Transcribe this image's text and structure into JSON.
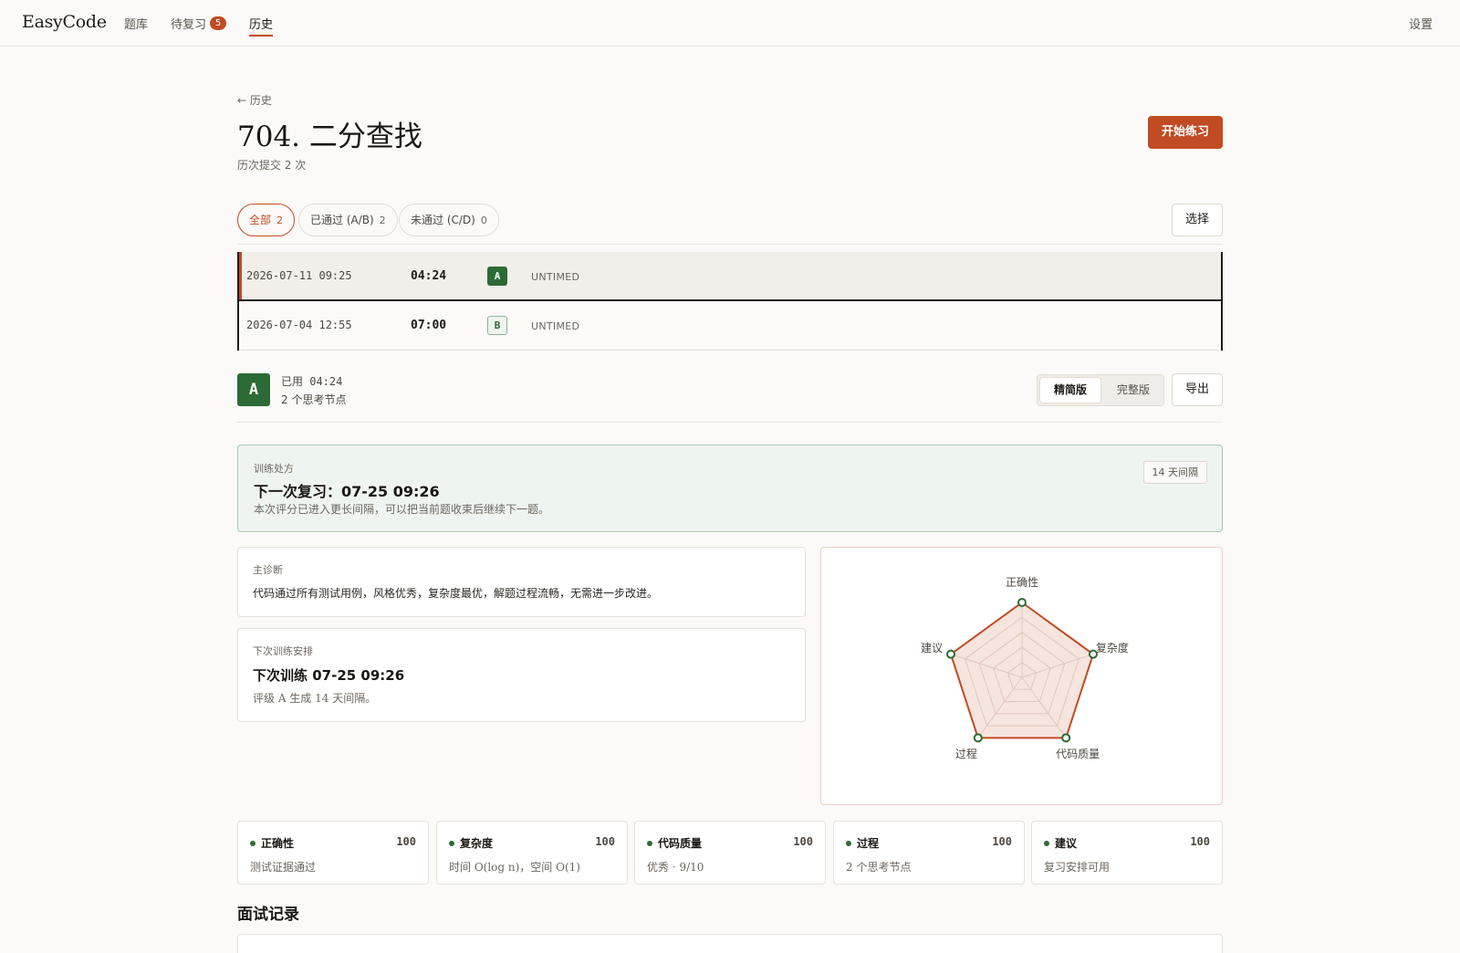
{
  "nav": {
    "brand": "EasyCode",
    "items": [
      {
        "label": "题库"
      },
      {
        "label": "待复习",
        "badge": "5"
      },
      {
        "label": "历史"
      }
    ],
    "settings": "设置",
    "accent": "#c14b22"
  },
  "header": {
    "back": "← 历史",
    "title": "704. 二分查找",
    "subtitle": "历次提交 2 次",
    "start_button": "开始练习"
  },
  "filters": [
    {
      "label": "全部",
      "count": "2"
    },
    {
      "label": "已通过 (A/B)",
      "count": "2"
    },
    {
      "label": "未通过 (C/D)",
      "count": "0"
    }
  ],
  "select_button": "选择",
  "history": [
    {
      "date": "2026-07-11 09:25",
      "time": "04:24",
      "grade": "A",
      "mode": "UNTIMED"
    },
    {
      "date": "2026-07-04 12:55",
      "time": "07:00",
      "grade": "B",
      "mode": "UNTIMED"
    }
  ],
  "summary": {
    "grade": "A",
    "used": "已用 04:24",
    "nodes": "2 个思考节点",
    "view_compact": "精简版",
    "view_full": "完整版",
    "export": "导出"
  },
  "prescription": {
    "label": "训练处方",
    "title": "下一次复习：07-25 09:26",
    "desc": "本次评分已进入更长间隔，可以把当前题收束后继续下一题。",
    "interval": "14 天间隔"
  },
  "diagnosis": {
    "label": "主诊断",
    "text": "代码通过所有测试用例，风格优秀，复杂度最优，解题过程流畅，无需进一步改进。"
  },
  "schedule": {
    "label": "下次训练安排",
    "title": "下次训练 07-25 09:26",
    "sub": "评级 A 生成 14 天间隔。"
  },
  "chart_data": {
    "type": "radar",
    "axes": [
      "正确性",
      "复杂度",
      "代码质量",
      "过程",
      "建议"
    ],
    "values": [
      100,
      100,
      100,
      100,
      100
    ],
    "max": 100,
    "rings": 5,
    "color": "#c14b22"
  },
  "metrics": [
    {
      "name": "正确性",
      "score": "100",
      "desc": "测试证据通过"
    },
    {
      "name": "复杂度",
      "score": "100",
      "desc": "时间 O(log n)，空间 O(1)"
    },
    {
      "name": "代码质量",
      "score": "100",
      "desc": "优秀 · 9/10"
    },
    {
      "name": "过程",
      "score": "100",
      "desc": "2 个思考节点"
    },
    {
      "name": "建议",
      "score": "100",
      "desc": "复习安排可用"
    }
  ],
  "interview": {
    "title": "面试记录"
  }
}
